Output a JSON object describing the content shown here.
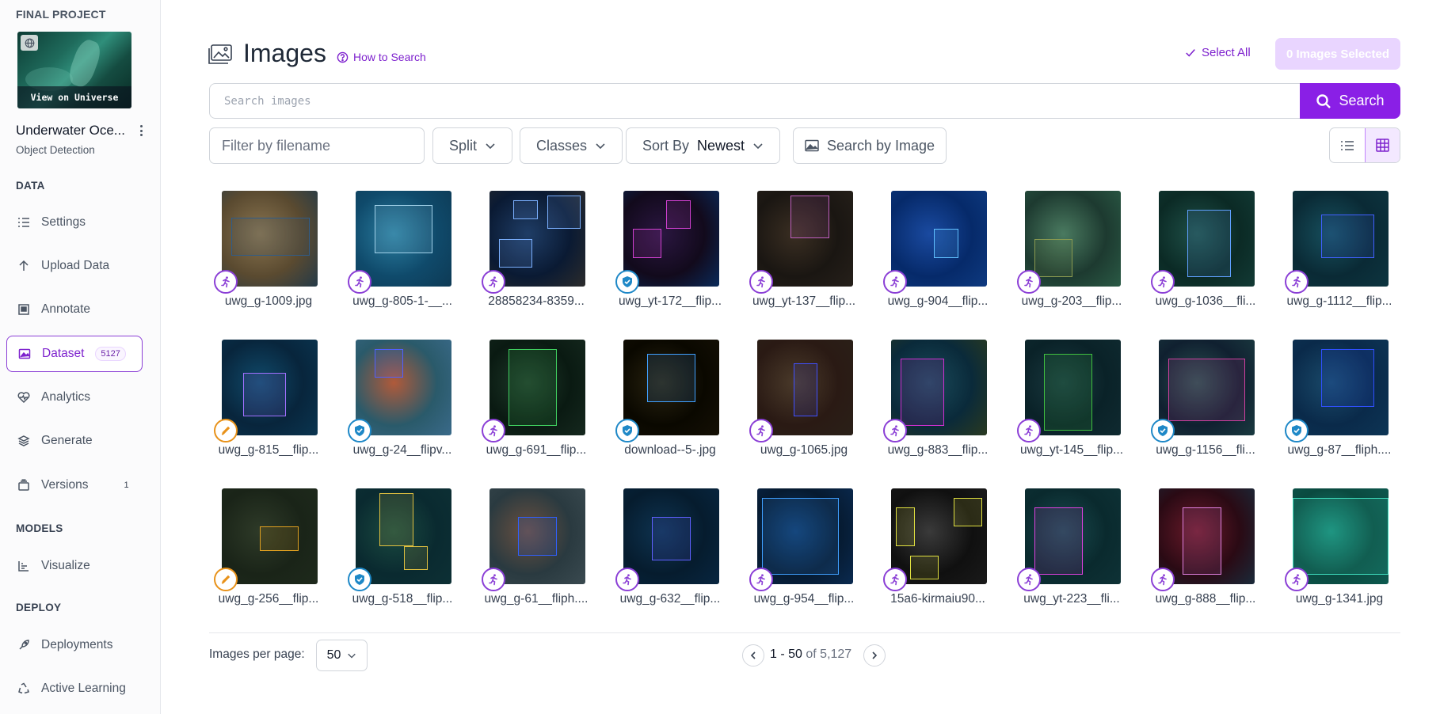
{
  "sidebar": {
    "project_section": "FINAL PROJECT",
    "view_universe": "View on Universe",
    "project_name": "Underwater Oce...",
    "project_type": "Object Detection",
    "sections": {
      "data": "DATA",
      "models": "MODELS",
      "deploy": "DEPLOY"
    },
    "items": [
      {
        "label": "Settings",
        "icon": "list-icon"
      },
      {
        "label": "Upload Data",
        "icon": "upload-arrow-icon"
      },
      {
        "label": "Annotate",
        "icon": "annotate-icon"
      },
      {
        "label": "Dataset",
        "icon": "image-icon",
        "badge": "5127",
        "active": true
      },
      {
        "label": "Analytics",
        "icon": "heart-pulse-icon"
      },
      {
        "label": "Generate",
        "icon": "layers-icon"
      },
      {
        "label": "Versions",
        "icon": "versions-icon",
        "badge": "1"
      },
      {
        "label": "Visualize",
        "icon": "chart-icon"
      },
      {
        "label": "Deployments",
        "icon": "rocket-icon"
      },
      {
        "label": "Active Learning",
        "icon": "recycle-icon"
      }
    ]
  },
  "header": {
    "title": "Images",
    "how_to_search": "How to Search",
    "select_all": "Select All",
    "selected_count": "0 Images Selected"
  },
  "search": {
    "placeholder": "Search images",
    "button": "Search"
  },
  "filters": {
    "filename_placeholder": "Filter by filename",
    "split": "Split",
    "classes": "Classes",
    "sort_label": "Sort By",
    "sort_value": "Newest",
    "search_by_image": "Search by Image"
  },
  "images": [
    {
      "name": "uwg_g-1009.jpg",
      "status": "run"
    },
    {
      "name": "uwg_g-805-1-__...",
      "status": "run"
    },
    {
      "name": "28858234-8359...",
      "status": "run"
    },
    {
      "name": "uwg_yt-172__flip...",
      "status": "ok"
    },
    {
      "name": "uwg_yt-137__flip...",
      "status": "run"
    },
    {
      "name": "uwg_g-904__flip...",
      "status": "run"
    },
    {
      "name": "uwg_g-203__flip...",
      "status": "run"
    },
    {
      "name": "uwg_g-1036__fli...",
      "status": "run"
    },
    {
      "name": "uwg_g-1112__flip...",
      "status": "run"
    },
    {
      "name": "uwg_g-815__flip...",
      "status": "edit"
    },
    {
      "name": "uwg_g-24__flipv...",
      "status": "ok"
    },
    {
      "name": "uwg_g-691__flip...",
      "status": "run"
    },
    {
      "name": "download--5-.jpg",
      "status": "ok"
    },
    {
      "name": "uwg_g-1065.jpg",
      "status": "run"
    },
    {
      "name": "uwg_g-883__flip...",
      "status": "run"
    },
    {
      "name": "uwg_yt-145__flip...",
      "status": "run"
    },
    {
      "name": "uwg_g-1156__fli...",
      "status": "ok"
    },
    {
      "name": "uwg_g-87__fliph....",
      "status": "ok"
    },
    {
      "name": "uwg_g-256__flip...",
      "status": "edit"
    },
    {
      "name": "uwg_g-518__flip...",
      "status": "ok"
    },
    {
      "name": "uwg_g-61__fliph....",
      "status": "run"
    },
    {
      "name": "uwg_g-632__flip...",
      "status": "run"
    },
    {
      "name": "uwg_g-954__flip...",
      "status": "run"
    },
    {
      "name": "15a6-kirmaiu90...",
      "status": "run"
    },
    {
      "name": "uwg_yt-223__fli...",
      "status": "run"
    },
    {
      "name": "uwg_g-888__flip...",
      "status": "run"
    },
    {
      "name": "uwg_g-1341.jpg",
      "status": "run"
    }
  ],
  "pagination": {
    "per_page_label": "Images per page:",
    "per_page": "50",
    "range": "1 - 50",
    "of_total": "of 5,127"
  },
  "colors": {
    "accent": "#8a1fe6",
    "accent_light": "#e9d5ff",
    "status_annotated": "#8b3fd6",
    "status_approved": "#1e88c7",
    "status_edit": "#e8921a"
  }
}
